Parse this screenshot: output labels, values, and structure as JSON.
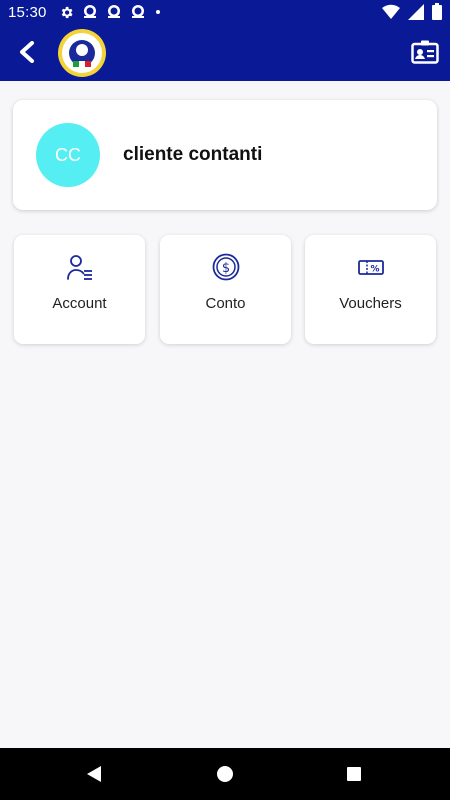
{
  "status_bar": {
    "time": "15:30",
    "icons": [
      "gear-icon",
      "notification-app-icon",
      "notification-app-icon",
      "notification-app-icon",
      "dot-icon"
    ],
    "right_icons": [
      "wifi-icon",
      "signal-icon",
      "battery-icon"
    ]
  },
  "app_bar": {
    "background": "#0a1a96",
    "back_icon": "chevron-left-icon",
    "logo": "club-logo",
    "logo_text": "A.S. POLISPORTIVA REAL AZZURRA",
    "action_icon": "contact-card-icon"
  },
  "profile": {
    "initials": "CC",
    "avatar_color": "#55eef2",
    "name": "cliente contanti"
  },
  "tiles": [
    {
      "label": "Account",
      "icon": "user-list-icon"
    },
    {
      "label": "Conto",
      "icon": "dollar-coin-icon"
    },
    {
      "label": "Vouchers",
      "icon": "percent-ticket-icon"
    }
  ],
  "accent_color": "#1a2a9c",
  "nav_bar": {
    "buttons": [
      "back-triangle-icon",
      "home-circle-icon",
      "recents-square-icon"
    ]
  }
}
